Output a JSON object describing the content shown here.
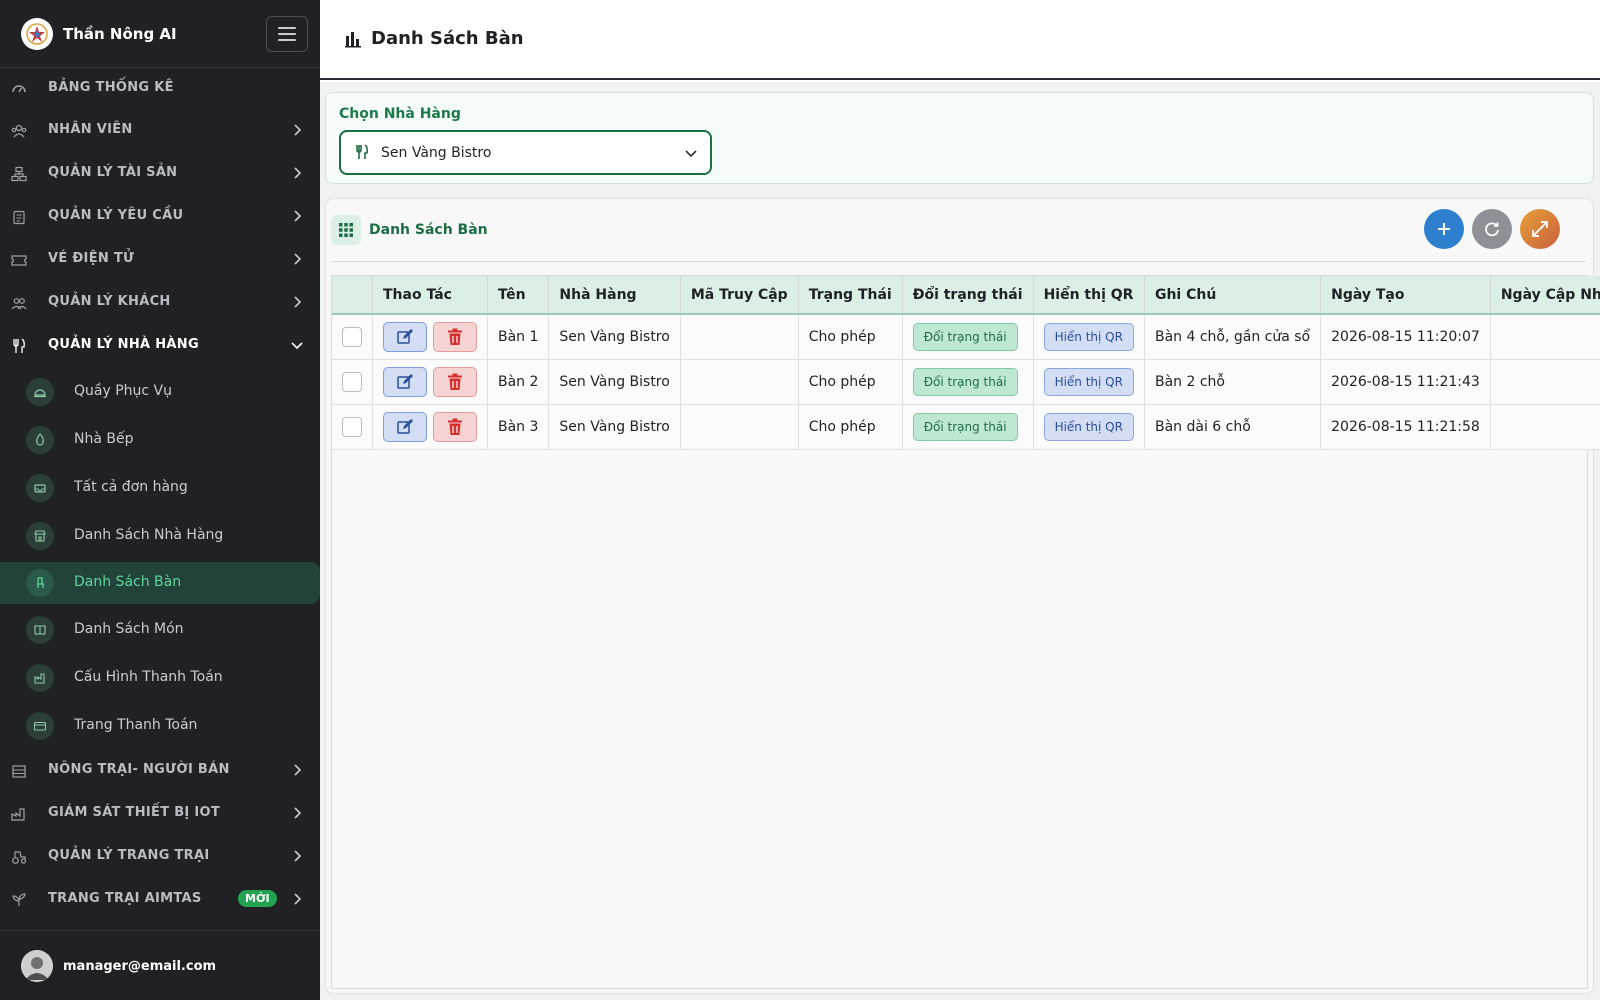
{
  "app": {
    "name": "Thần Nông AI",
    "page_title": "Danh Sách Bàn"
  },
  "sidebar": {
    "menu": [
      {
        "label": "BẢNG THỐNG KÊ",
        "icon": "dashboard-icon",
        "has_children": false
      },
      {
        "label": "NHÂN VIÊN",
        "icon": "staff-icon",
        "has_children": true
      },
      {
        "label": "QUẢN LÝ TÀI SẢN",
        "icon": "asset-icon",
        "has_children": true
      },
      {
        "label": "QUẢN LÝ YÊU CẦU",
        "icon": "clipboard-icon",
        "has_children": true
      },
      {
        "label": "VÉ ĐIỆN TỬ",
        "icon": "ticket-icon",
        "has_children": true
      },
      {
        "label": "QUẢN LÝ KHÁCH",
        "icon": "users-icon",
        "has_children": true
      },
      {
        "label": "QUẢN LÝ NHÀ HÀNG",
        "icon": "fork-knife-icon",
        "has_children": true,
        "open": true
      }
    ],
    "submenu": [
      {
        "label": "Quầy Phục Vụ",
        "icon": "cloche-icon"
      },
      {
        "label": "Nhà Bếp",
        "icon": "flame-icon"
      },
      {
        "label": "Tất cả đơn hàng",
        "icon": "tray-icon"
      },
      {
        "label": "Danh Sách Nhà Hàng",
        "icon": "store-icon"
      },
      {
        "label": "Danh Sách Bàn",
        "icon": "chair-icon",
        "active": true
      },
      {
        "label": "Danh Sách Món",
        "icon": "menu-book-icon"
      },
      {
        "label": "Cấu Hình Thanh Toán",
        "icon": "factory-icon"
      },
      {
        "label": "Trang Thanh Toán",
        "icon": "card-icon"
      }
    ],
    "menu_bottom": [
      {
        "label": "NÔNG TRẠI- NGƯỜI BÁN",
        "icon": "barn-icon",
        "has_children": true
      },
      {
        "label": "GIÁM SÁT THIẾT BỊ IOT",
        "icon": "iot-icon",
        "has_children": true
      },
      {
        "label": "QUẢN LÝ TRANG TRẠI",
        "icon": "tractor-icon",
        "has_children": true
      },
      {
        "label": "TRANG TRẠI AIMTAS",
        "icon": "plant-icon",
        "has_children": true,
        "badge": "MỚI"
      }
    ],
    "user_email": "manager@email.com"
  },
  "restaurant_select": {
    "label": "Chọn Nhà Hàng",
    "value": "Sen Vàng Bistro"
  },
  "table_card": {
    "title": "Danh Sách Bàn",
    "columns": [
      "",
      "Thao Tác",
      "Tên",
      "Nhà Hàng",
      "Mã Truy Cập",
      "Trạng Thái",
      "Đổi trạng thái",
      "Hiển thị QR",
      "Ghi Chú",
      "Ngày Tạo",
      "Ngày Cập Nhật"
    ],
    "toggle_label": "Đổi trạng thái",
    "qr_label": "Hiển thị QR",
    "rows": [
      {
        "name": "Bàn 1",
        "restaurant": "Sen Vàng Bistro",
        "access_code": "",
        "status": "Cho phép",
        "note": "Bàn 4 chỗ, gần cửa sổ",
        "created": "2026-08-15 11:20:07",
        "updated": ""
      },
      {
        "name": "Bàn 2",
        "restaurant": "Sen Vàng Bistro",
        "access_code": "",
        "status": "Cho phép",
        "note": "Bàn 2 chỗ",
        "created": "2026-08-15 11:21:43",
        "updated": ""
      },
      {
        "name": "Bàn 3",
        "restaurant": "Sen Vàng Bistro",
        "access_code": "",
        "status": "Cho phép",
        "note": "Bàn dài 6 chỗ",
        "created": "2026-08-15 11:21:58",
        "updated": ""
      }
    ]
  },
  "colors": {
    "sidebar_bg": "#1f2125",
    "accent_green": "#1d6e44",
    "active_text": "#5fd69c",
    "add_blue": "#2f7fcf",
    "badge_green": "#22a352"
  }
}
